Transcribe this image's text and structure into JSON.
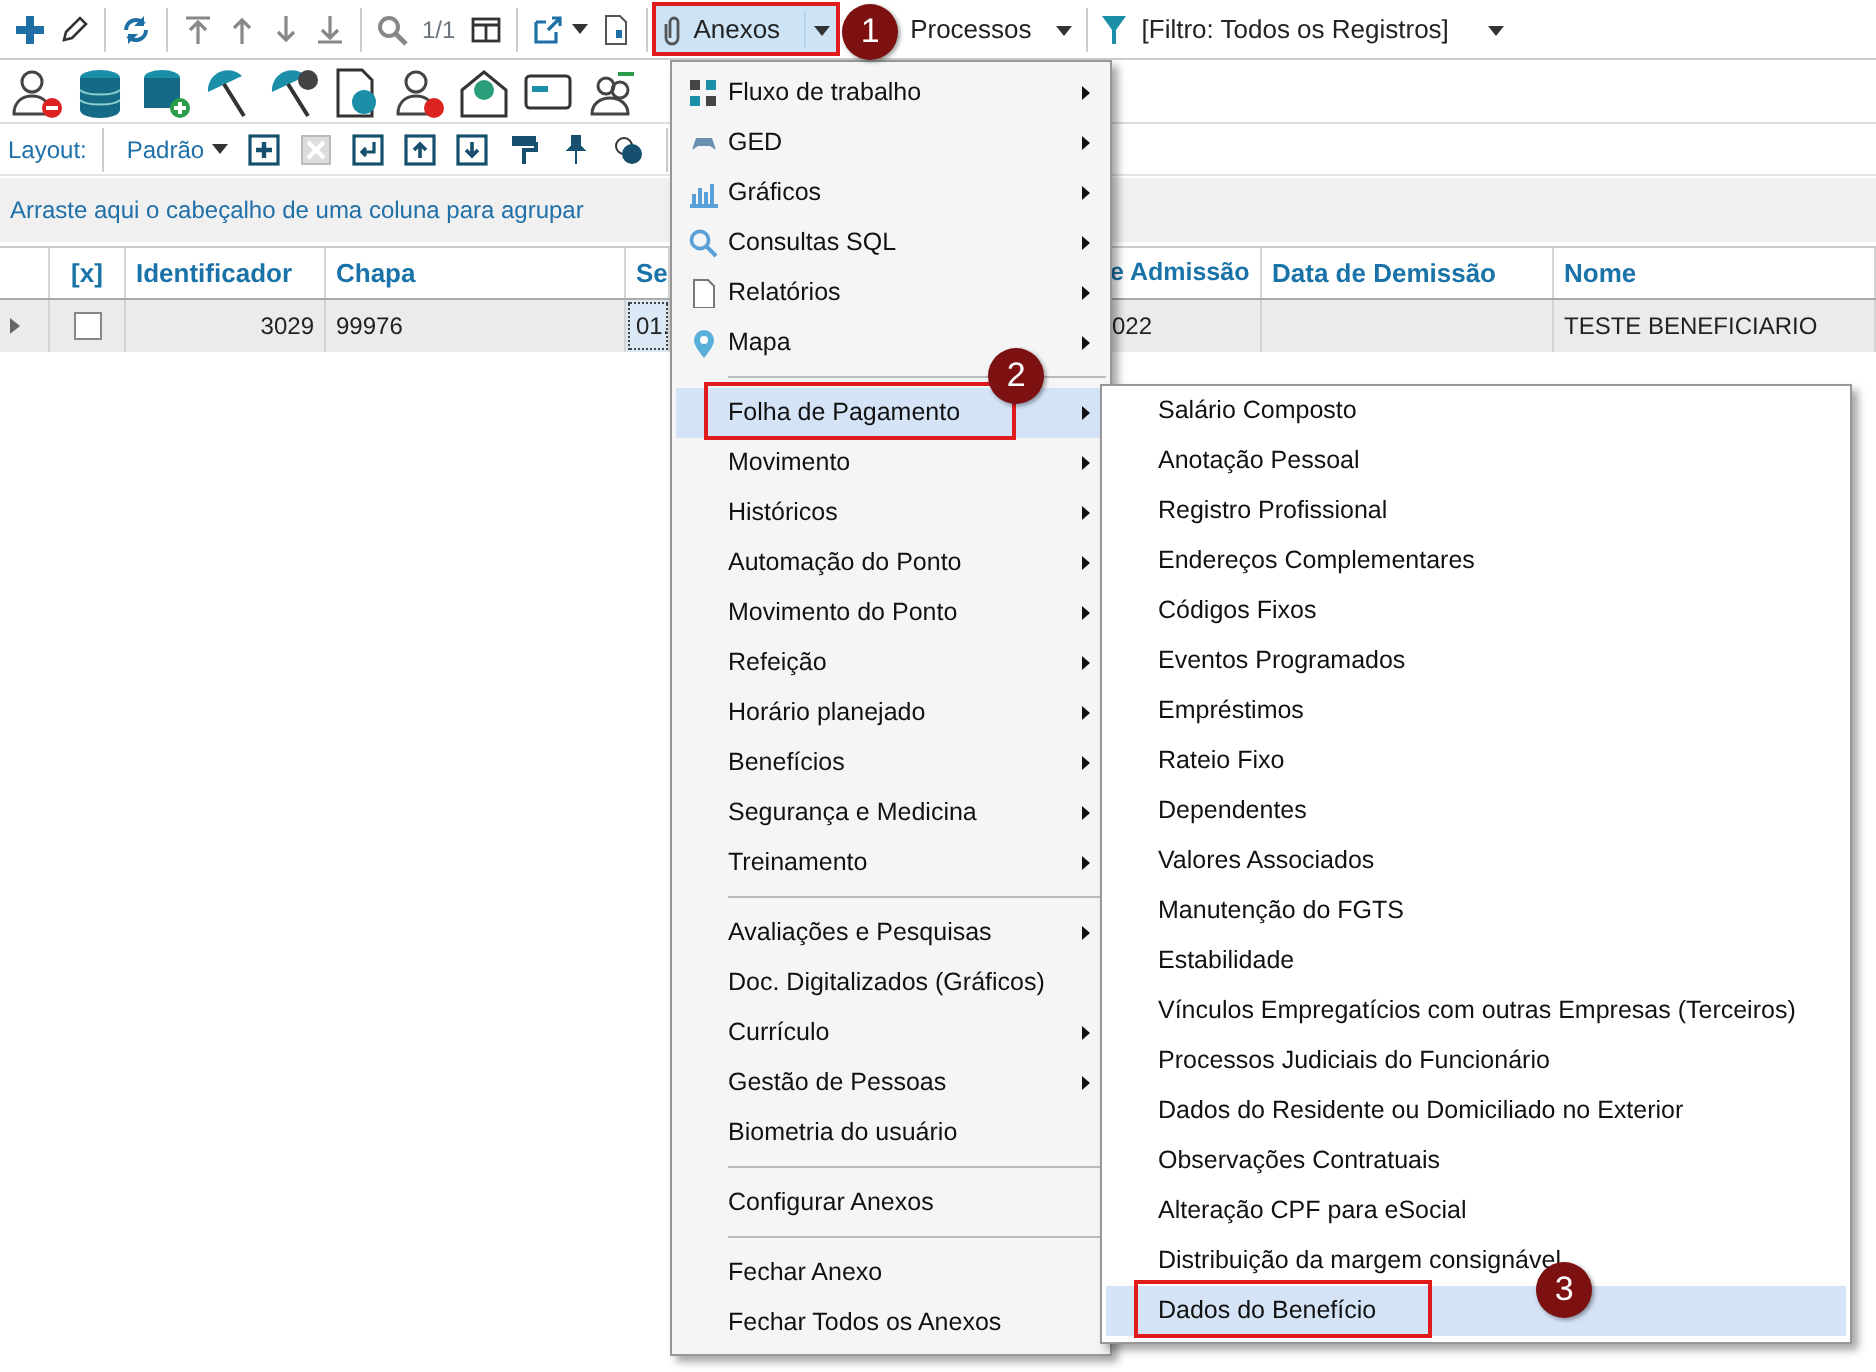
{
  "toolbar": {
    "page_counter": "1/1",
    "attachments_button": {
      "label": "Anexos",
      "selected": true,
      "step": "1"
    },
    "processes_button": {
      "label": "Processos"
    },
    "filter_button": {
      "label": "[Filtro: Todos os Registros]"
    }
  },
  "layout_bar": {
    "label": "Layout:",
    "layout_value": "Padrão"
  },
  "group_panel": {
    "hint": "Arraste aqui o cabeçalho de uma coluna para agrupar"
  },
  "table": {
    "columns": [
      "[x]",
      "Identificador",
      "Chapa",
      "Se",
      "e Admissão",
      "Data de Demissão",
      "Nome"
    ],
    "rows": [
      {
        "checked": false,
        "cells": [
          "",
          "3029",
          "99976",
          "01.",
          "022",
          "",
          "TESTE BENEFICIARIO"
        ]
      }
    ]
  },
  "attachments_menu": {
    "groups": [
      {
        "items": [
          {
            "label": "Fluxo de trabalho",
            "has_submenu": true,
            "selected": false
          },
          {
            "label": "GED",
            "has_submenu": true,
            "selected": false
          },
          {
            "label": "Gráficos",
            "has_submenu": true,
            "selected": false
          },
          {
            "label": "Consultas SQL",
            "has_submenu": true,
            "selected": false
          },
          {
            "label": "Relatórios",
            "has_submenu": true,
            "selected": false
          },
          {
            "label": "Mapa",
            "has_submenu": true,
            "selected": false
          }
        ]
      },
      {
        "items": [
          {
            "label": "Folha de Pagamento",
            "has_submenu": true,
            "selected": true,
            "step": "2"
          },
          {
            "label": "Movimento",
            "has_submenu": true,
            "selected": false
          },
          {
            "label": "Históricos",
            "has_submenu": true,
            "selected": false
          },
          {
            "label": "Automação do Ponto",
            "has_submenu": true,
            "selected": false
          },
          {
            "label": "Movimento do Ponto",
            "has_submenu": true,
            "selected": false
          },
          {
            "label": "Refeição",
            "has_submenu": true,
            "selected": false
          },
          {
            "label": "Horário planejado",
            "has_submenu": true,
            "selected": false
          },
          {
            "label": "Benefícios",
            "has_submenu": true,
            "selected": false
          },
          {
            "label": "Segurança e Medicina",
            "has_submenu": true,
            "selected": false
          },
          {
            "label": "Treinamento",
            "has_submenu": true,
            "selected": false
          }
        ]
      },
      {
        "items": [
          {
            "label": "Avaliações e Pesquisas",
            "has_submenu": true,
            "selected": false
          },
          {
            "label": "Doc. Digitalizados (Gráficos)",
            "has_submenu": false,
            "selected": false
          },
          {
            "label": "Currículo",
            "has_submenu": true,
            "selected": false
          },
          {
            "label": "Gestão de Pessoas",
            "has_submenu": true,
            "selected": false
          },
          {
            "label": "Biometria do usuário",
            "has_submenu": false,
            "selected": false
          }
        ]
      },
      {
        "items": [
          {
            "label": "Configurar Anexos",
            "has_submenu": false,
            "selected": false
          }
        ]
      },
      {
        "items": [
          {
            "label": "Fechar Anexo",
            "has_submenu": false,
            "selected": false
          },
          {
            "label": "Fechar Todos os Anexos",
            "has_submenu": false,
            "selected": false
          }
        ]
      }
    ]
  },
  "payroll_submenu": {
    "items": [
      {
        "label": "Salário Composto",
        "selected": false
      },
      {
        "label": "Anotação Pessoal",
        "selected": false
      },
      {
        "label": "Registro Profissional",
        "selected": false
      },
      {
        "label": "Endereços Complementares",
        "selected": false
      },
      {
        "label": "Códigos Fixos",
        "selected": false
      },
      {
        "label": "Eventos Programados",
        "selected": false
      },
      {
        "label": "Empréstimos",
        "selected": false
      },
      {
        "label": "Rateio Fixo",
        "selected": false
      },
      {
        "label": "Dependentes",
        "selected": false
      },
      {
        "label": "Valores Associados",
        "selected": false
      },
      {
        "label": "Manutenção do FGTS",
        "selected": false
      },
      {
        "label": "Estabilidade",
        "selected": false
      },
      {
        "label": "Vínculos Empregatícios com outras Empresas (Terceiros)",
        "selected": false
      },
      {
        "label": "Processos Judiciais do Funcionário",
        "selected": false
      },
      {
        "label": "Dados do Residente ou Domiciliado no Exterior",
        "selected": false
      },
      {
        "label": "Observações Contratuais",
        "selected": false
      },
      {
        "label": "Alteração CPF para eSocial",
        "selected": false
      },
      {
        "label": "Distribuição da margem consignável",
        "selected": false
      },
      {
        "label": "Dados do Benefício",
        "selected": true,
        "step": "3"
      }
    ]
  }
}
